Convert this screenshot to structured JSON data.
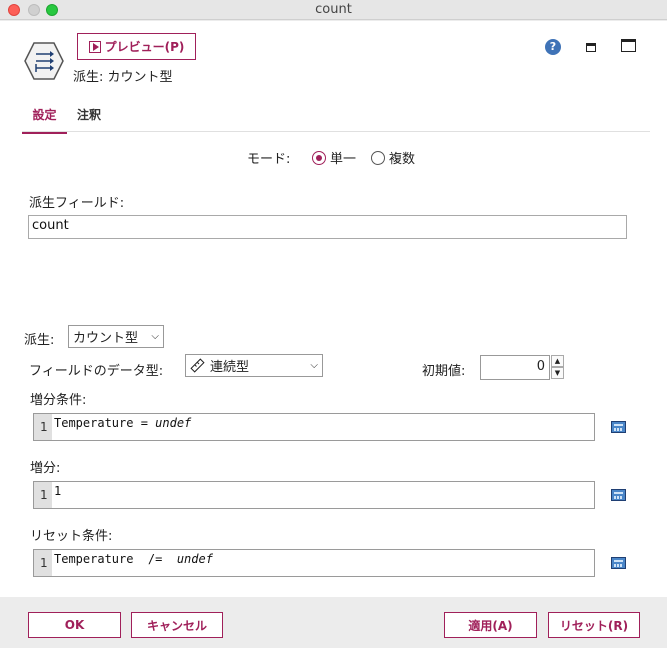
{
  "window": {
    "title": "count"
  },
  "header": {
    "preview_label": "プレビュー(P)",
    "node_title": "派生: カウント型",
    "help_glyph": "?"
  },
  "tabs": [
    {
      "label": "設定"
    },
    {
      "label": "注釈"
    }
  ],
  "mode": {
    "label": "モード:",
    "options": [
      "単一",
      "複数"
    ],
    "selected": "単一"
  },
  "derive_field": {
    "label": "派生フィールド:",
    "value": "count"
  },
  "derive": {
    "label": "派生:",
    "value": "カウント型"
  },
  "data_type": {
    "label": "フィールドのデータ型:",
    "value": "連続型"
  },
  "initial_value": {
    "label": "初期値:",
    "value": "0"
  },
  "increment_condition": {
    "label": "増分条件:",
    "line": "1",
    "code_text": "Temperature = ",
    "code_italic": "undef"
  },
  "increment": {
    "label": "増分:",
    "line": "1",
    "code_text": "1"
  },
  "reset_condition": {
    "label": "リセット条件:",
    "line": "1",
    "code_text": "Temperature  /=  ",
    "code_italic": "undef"
  },
  "buttons": {
    "ok": "OK",
    "cancel": "キャンセル",
    "apply": "適用(A)",
    "reset": "リセット(R)"
  },
  "colors": {
    "accent": "#a0205a",
    "help": "#3f73b7"
  }
}
